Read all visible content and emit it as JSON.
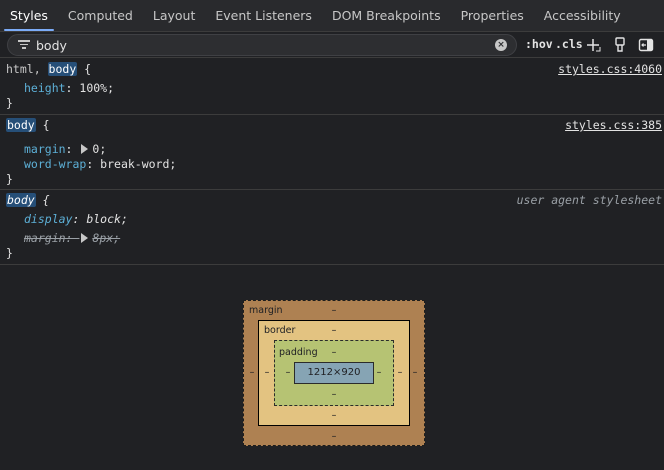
{
  "tabs": [
    "Styles",
    "Computed",
    "Layout",
    "Event Listeners",
    "DOM Breakpoints",
    "Properties",
    "Accessibility"
  ],
  "filter": {
    "value": "body",
    "hov_label": ":hov",
    "cls_label": ".cls"
  },
  "rules": [
    {
      "selector_prefix": "html, ",
      "selector_match": "body",
      "open_brace": " {",
      "source": "styles.css:4060",
      "declarations": [
        {
          "property": "height",
          "value": "100%;"
        }
      ]
    },
    {
      "selector_match": "body",
      "open_brace": " {",
      "source": "styles.css:385",
      "declarations": [
        {
          "property": "margin",
          "value": "0;"
        },
        {
          "property": "word-wrap",
          "value": "break-word;"
        }
      ]
    },
    {
      "selector_match": "body",
      "open_brace": " {",
      "source": "user agent stylesheet",
      "declarations": [
        {
          "property": "display",
          "value": "block;"
        },
        {
          "property": "margin",
          "value": "8px;"
        }
      ]
    }
  ],
  "close_brace": "}",
  "colon": ": ",
  "box_model": {
    "margin_label": "margin",
    "border_label": "border",
    "padding_label": "padding",
    "content_size": "1212×920",
    "dash": "–"
  },
  "colors": {
    "accent": "#7cacf8",
    "property": "#5db0d7",
    "selector_highlight": "#264f78",
    "margin": "#ae8152",
    "border": "#e3c381",
    "padding": "#b6c373",
    "content": "#86a4b4"
  }
}
